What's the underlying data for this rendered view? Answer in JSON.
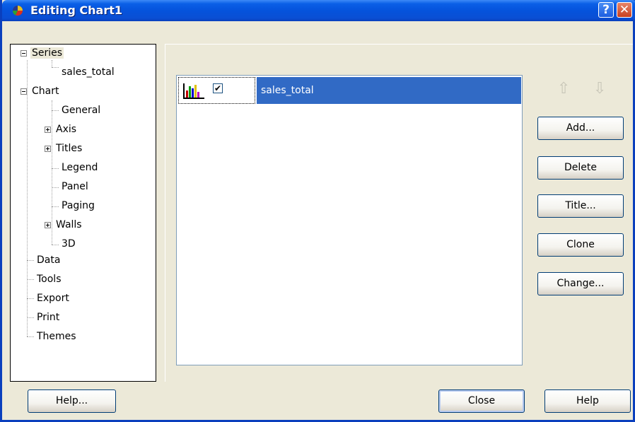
{
  "window": {
    "title": "Editing Chart1",
    "help_glyph": "?",
    "close_glyph": "✕"
  },
  "tree": {
    "items": [
      {
        "label": "Series"
      },
      {
        "label": "sales_total"
      },
      {
        "label": "Chart"
      },
      {
        "label": "General"
      },
      {
        "label": "Axis"
      },
      {
        "label": "Titles"
      },
      {
        "label": "Legend"
      },
      {
        "label": "Panel"
      },
      {
        "label": "Paging"
      },
      {
        "label": "Walls"
      },
      {
        "label": "3D"
      },
      {
        "label": "Data"
      },
      {
        "label": "Tools"
      },
      {
        "label": "Export"
      },
      {
        "label": "Print"
      },
      {
        "label": "Themes"
      }
    ],
    "selected": "Series"
  },
  "series_list": {
    "rows": [
      {
        "name": "sales_total",
        "checked": true,
        "check_glyph": "✔",
        "icon": "bar-chart-icon"
      }
    ]
  },
  "side_buttons": {
    "up_arrow": "⇧",
    "down_arrow": "⇩",
    "add": "Add...",
    "delete": "Delete",
    "title": "Title...",
    "clone": "Clone",
    "change": "Change..."
  },
  "footer": {
    "help_left": "Help...",
    "close": "Close",
    "help_right": "Help"
  },
  "colors": {
    "title_bar": "#0553dc",
    "selection": "#316ac5",
    "dialog_bg": "#ece9d8"
  }
}
